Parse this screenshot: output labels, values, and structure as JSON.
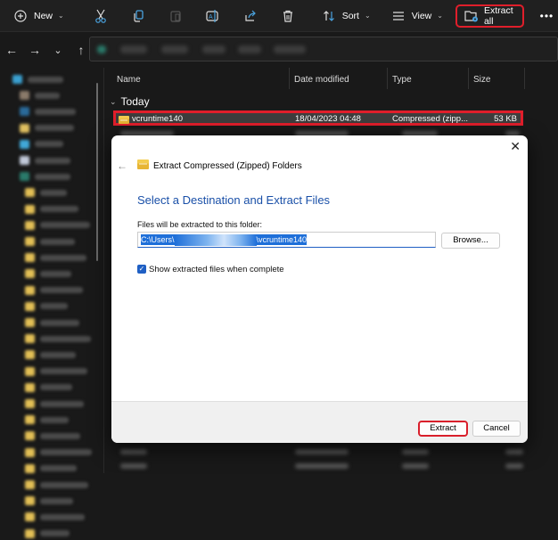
{
  "toolbar": {
    "new_label": "New",
    "sort_label": "Sort",
    "view_label": "View",
    "extract_all_label": "Extract all",
    "more_label": "•••",
    "icons": [
      "plus-circle-icon",
      "cut-icon",
      "copy-icon",
      "paste-icon",
      "rename-icon",
      "share-icon",
      "delete-icon",
      "sort-icon",
      "view-icon",
      "extract-folder-icon",
      "more-icon"
    ]
  },
  "nav": {
    "back": "←",
    "forward": "→",
    "recent": "⌄",
    "up": "↑"
  },
  "columns": {
    "name": "Name",
    "date": "Date modified",
    "type": "Type",
    "size": "Size"
  },
  "group_label": "Today",
  "selected_file": {
    "name": "vcruntime140",
    "date": "18/04/2023 04:48",
    "type": "Compressed (zipp...",
    "size": "53 KB"
  },
  "dialog": {
    "close": "✕",
    "back": "←",
    "title": "Extract Compressed (Zipped) Folders",
    "heading": "Select a Destination and Extract Files",
    "folder_label": "Files will be extracted to this folder:",
    "path_prefix": "C:\\Users\\",
    "path_suffix": "\\vcruntime140",
    "browse_label": "Browse...",
    "checkbox_checked": true,
    "checkbox_label": "Show extracted files when complete",
    "extract_label": "Extract",
    "cancel_label": "Cancel"
  },
  "colors": {
    "highlight": "#e01e2b",
    "accent": "#1f5fc4",
    "heading": "#1a50a8"
  }
}
